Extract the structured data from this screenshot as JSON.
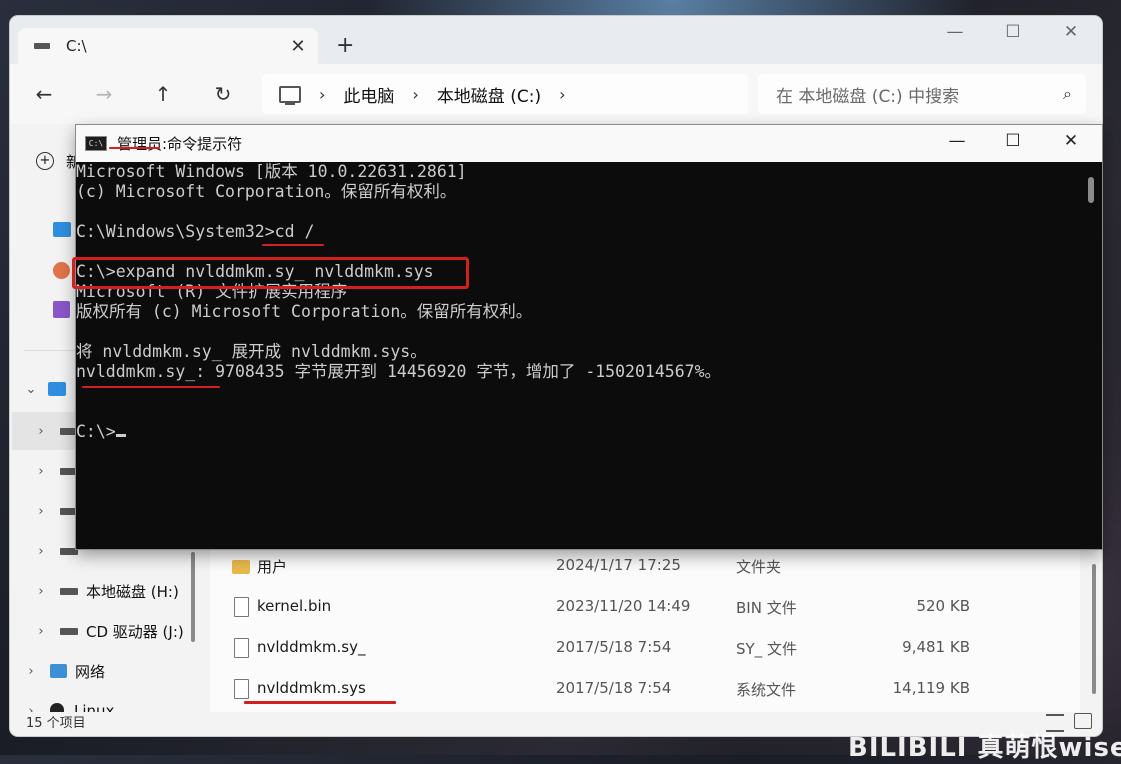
{
  "explorer": {
    "tab_title": "C:\\",
    "breadcrumb": [
      "此电脑",
      "本地磁盘 (C:)"
    ],
    "search_placeholder": "在 本地磁盘 (C:) 中搜索",
    "new_label": "新",
    "status_count": "15 个项目",
    "sidebar": {
      "drive_h": "本地磁盘 (H:)",
      "cd_drive": "CD 驱动器 (J:)",
      "network": "网络",
      "linux": "Linux"
    },
    "files": [
      {
        "name": "用户",
        "date": "2024/1/17 17:25",
        "type": "文件夹",
        "size": ""
      },
      {
        "name": "kernel.bin",
        "date": "2023/11/20 14:49",
        "type": "BIN 文件",
        "size": "520 KB"
      },
      {
        "name": "nvlddmkm.sy_",
        "date": "2017/5/18 7:54",
        "type": "SY_ 文件",
        "size": "9,481 KB"
      },
      {
        "name": "nvlddmkm.sys",
        "date": "2017/5/18 7:54",
        "type": "系统文件",
        "size": "14,119 KB"
      }
    ]
  },
  "cmd": {
    "title_admin": "管理员:",
    "title_rest": " 命令提示符",
    "lines": [
      "Microsoft Windows [版本 10.0.22631.2861]",
      "(c) Microsoft Corporation。保留所有权利。",
      "",
      "C:\\Windows\\System32>cd /",
      "",
      "C:\\>expand nvlddmkm.sy_ nvlddmkm.sys",
      "Microsoft (R) 文件扩展实用程序",
      "版权所有 (c) Microsoft Corporation。保留所有权利。",
      "",
      "将 nvlddmkm.sy_ 展开成 nvlddmkm.sys。",
      "nvlddmkm.sy_: 9708435 字节展开到 14456920 字节，增加了 -1502014567%。",
      "",
      "",
      "C:\\>"
    ]
  },
  "watermark": "BILIBILI 真萌恨wise",
  "colors": {
    "annotation_red": "#d21f1f",
    "console_bg": "#0c0c0c",
    "console_text": "#cccccc"
  }
}
